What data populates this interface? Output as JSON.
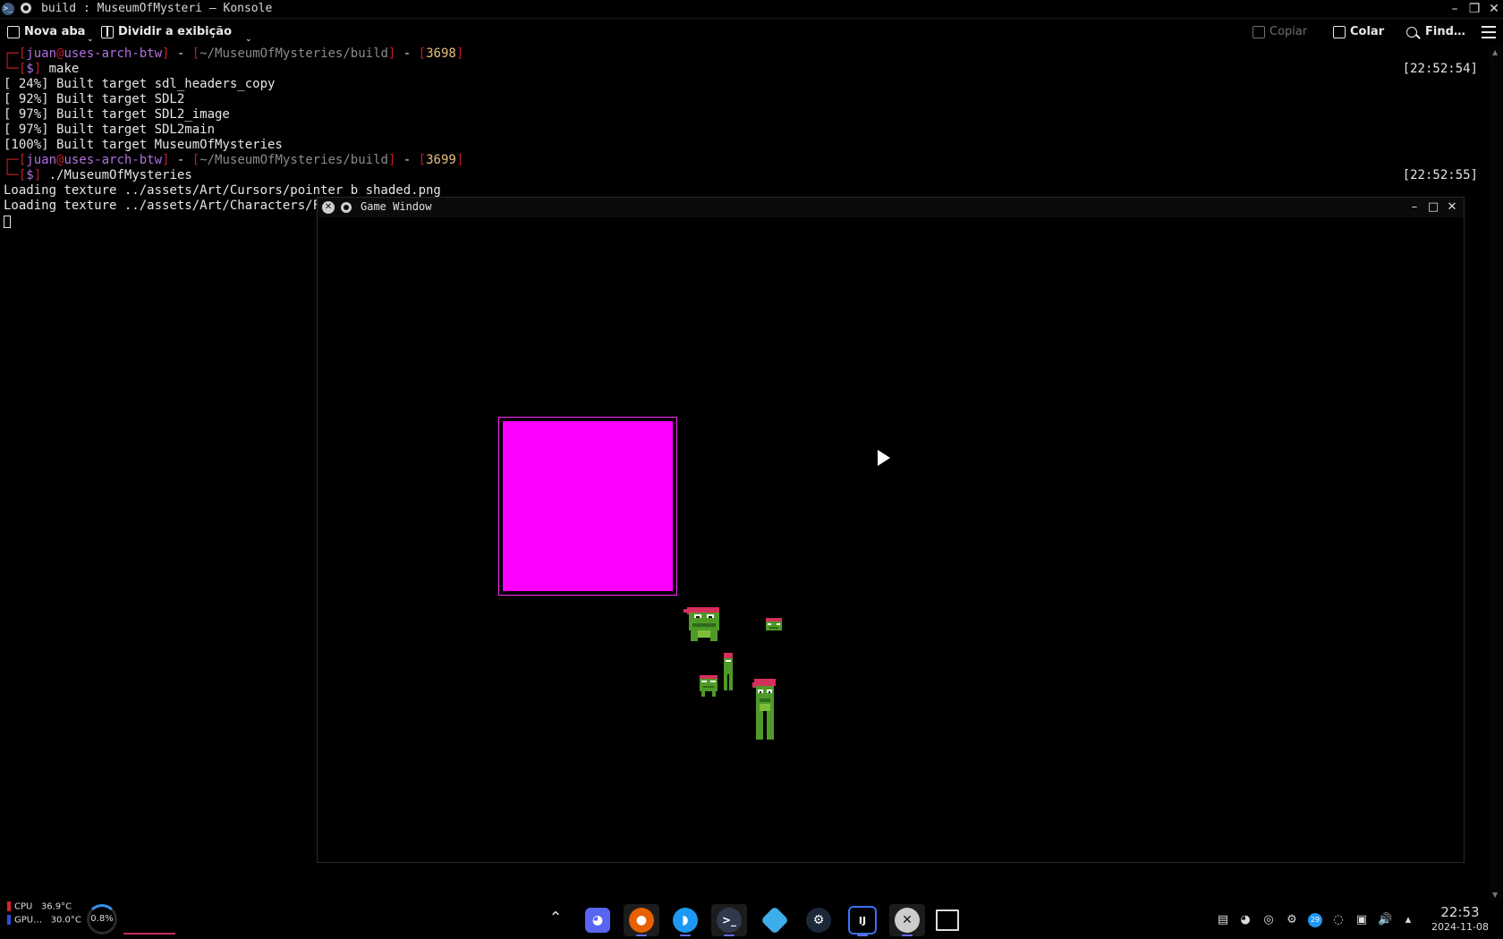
{
  "window": {
    "title": "build : MuseumOfMysteri — Konsole"
  },
  "toolbar": {
    "new_tab": "Nova aba",
    "split_view": "Dividir a exibição",
    "copy": "Copiar",
    "paste": "Colar",
    "find": "Find…"
  },
  "terminal": {
    "prompt1": {
      "user": "juan",
      "host": "uses-arch-btw",
      "path": "~/MuseumOfMysteries/build",
      "hist": "3698",
      "command": "make",
      "timestamp": "[22:52:54]"
    },
    "make_output": [
      "[ 24%] Built target sdl_headers_copy",
      "[ 92%] Built target SDL2",
      "[ 97%] Built target SDL2_image",
      "[ 97%] Built target SDL2main",
      "[100%] Built target MuseumOfMysteries"
    ],
    "prompt2": {
      "user": "juan",
      "host": "uses-arch-btw",
      "path": "~/MuseumOfMysteries/build",
      "hist": "3699",
      "command": "./MuseumOfMysteries",
      "timestamp": "[22:52:55]"
    },
    "log": [
      "Loading texture ../assets/Art/Cursors/pointer_b_shaded.png",
      "Loading texture ../assets/Art/Characters/Fro"
    ]
  },
  "game_window": {
    "title": "Game Window"
  },
  "taskbar": {
    "cpu_label": "CPU",
    "cpu_temp": "36.9°C",
    "gpu_label": "GPU…",
    "gpu_temp": "30.0°C",
    "cpu_load": "0.8%",
    "apps": [
      "discord",
      "firefox",
      "dolphin",
      "konsole",
      "software-store",
      "steam",
      "intellij-idea",
      "x-window",
      "empty-window"
    ],
    "tray_badge": "29",
    "time": "22:53",
    "date": "2024-11-08"
  }
}
